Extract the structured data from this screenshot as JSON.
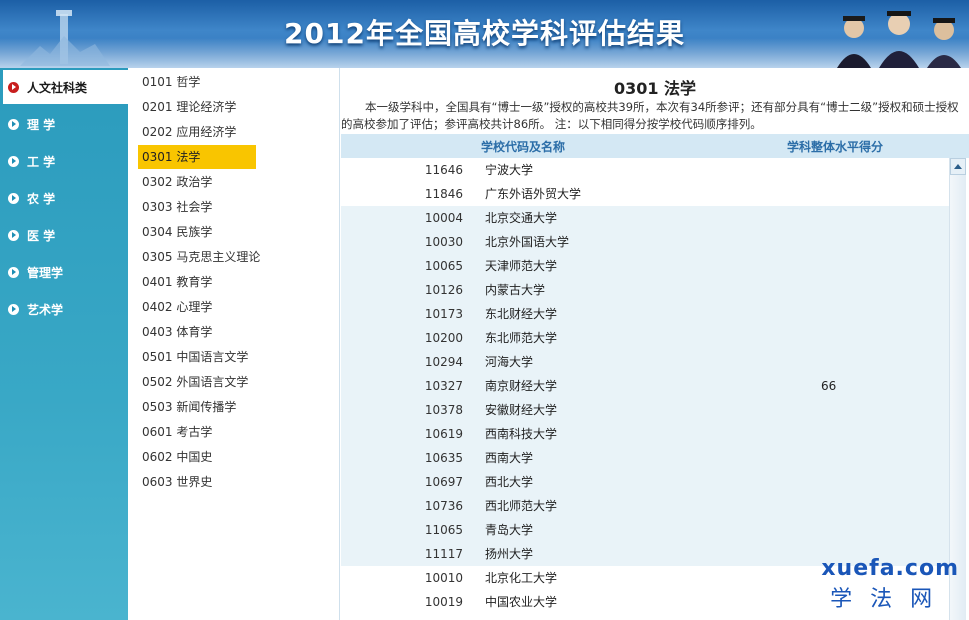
{
  "banner": {
    "title": "2012年全国高校学科评估结果"
  },
  "categories": [
    {
      "label": "人文社科类",
      "active": true
    },
    {
      "label": "理 学",
      "active": false
    },
    {
      "label": "工 学",
      "active": false
    },
    {
      "label": "农 学",
      "active": false
    },
    {
      "label": "医 学",
      "active": false
    },
    {
      "label": "管理学",
      "active": false
    },
    {
      "label": "艺术学",
      "active": false
    }
  ],
  "subjects": [
    {
      "label": "0101 哲学"
    },
    {
      "label": "0201 理论经济学"
    },
    {
      "label": "0202 应用经济学"
    },
    {
      "label": "0301 法学",
      "active": true
    },
    {
      "label": "0302 政治学"
    },
    {
      "label": "0303 社会学"
    },
    {
      "label": "0304 民族学"
    },
    {
      "label": "0305 马克思主义理论"
    },
    {
      "label": "0401 教育学"
    },
    {
      "label": "0402 心理学"
    },
    {
      "label": "0403 体育学"
    },
    {
      "label": "0501 中国语言文学"
    },
    {
      "label": "0502 外国语言文学"
    },
    {
      "label": "0503 新闻传播学"
    },
    {
      "label": "0601 考古学"
    },
    {
      "label": "0602 中国史"
    },
    {
      "label": "0603 世界史"
    }
  ],
  "main": {
    "title": "0301 法学",
    "intro": "本一级学科中，全国具有“博士一级”授权的高校共39所，本次有34所参评；还有部分具有“博士二级”授权和硕士授权的高校参加了评估；参评高校共计86所。 注：以下相同得分按学校代码顺序排列。",
    "col_school": "学校代码及名称",
    "col_score": "学科整体水平得分"
  },
  "table": {
    "rows": [
      {
        "code": "11646",
        "name": "宁波大学",
        "score": ""
      },
      {
        "code": "11846",
        "name": "广东外语外贸大学",
        "score": ""
      },
      {
        "code": "10004",
        "name": "北京交通大学",
        "score": ""
      },
      {
        "code": "10030",
        "name": "北京外国语大学",
        "score": ""
      },
      {
        "code": "10065",
        "name": "天津师范大学",
        "score": ""
      },
      {
        "code": "10126",
        "name": "内蒙古大学",
        "score": ""
      },
      {
        "code": "10173",
        "name": "东北财经大学",
        "score": ""
      },
      {
        "code": "10200",
        "name": "东北师范大学",
        "score": ""
      },
      {
        "code": "10294",
        "name": "河海大学",
        "score": ""
      },
      {
        "code": "10327",
        "name": "南京财经大学",
        "score": "66"
      },
      {
        "code": "10378",
        "name": "安徽财经大学",
        "score": ""
      },
      {
        "code": "10619",
        "name": "西南科技大学",
        "score": ""
      },
      {
        "code": "10635",
        "name": "西南大学",
        "score": ""
      },
      {
        "code": "10697",
        "name": "西北大学",
        "score": ""
      },
      {
        "code": "10736",
        "name": "西北师范大学",
        "score": ""
      },
      {
        "code": "11065",
        "name": "青岛大学",
        "score": ""
      },
      {
        "code": "11117",
        "name": "扬州大学",
        "score": ""
      },
      {
        "code": "10010",
        "name": "北京化工大学",
        "score": ""
      },
      {
        "code": "10019",
        "name": "中国农业大学",
        "score": ""
      }
    ],
    "shaded_rows": [
      2,
      3,
      4,
      5,
      6,
      7,
      8,
      9,
      10,
      11,
      12,
      13,
      14,
      15,
      16
    ]
  },
  "watermark": {
    "line1": "xuefa.com",
    "line2": "学法网"
  },
  "colors": {
    "accent": "#f9c500",
    "sidebar": "#2b9bbd",
    "banner": "#2b6fb6",
    "header_text": "#2c6ea8"
  }
}
